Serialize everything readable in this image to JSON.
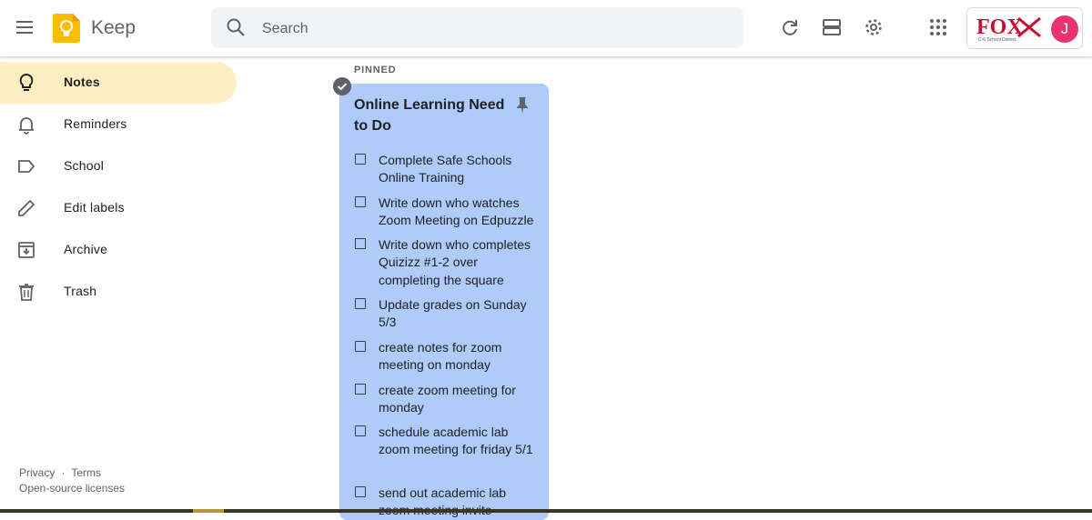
{
  "header": {
    "app_title": "Keep",
    "search_placeholder": "Search",
    "icons": [
      "menu-icon",
      "keep-logo-icon",
      "search-icon",
      "refresh-icon",
      "list-view-icon",
      "settings-icon",
      "apps-grid-icon"
    ],
    "account": {
      "org_logo_text": "FOX",
      "org_logo_subtext": "C-6 School District",
      "avatar_initial": "J",
      "avatar_color": "#e8336d"
    }
  },
  "sidebar": {
    "items": [
      {
        "label": "Notes",
        "icon": "lightbulb-icon",
        "active": true
      },
      {
        "label": "Reminders",
        "icon": "bell-icon",
        "active": false
      },
      {
        "label": "School",
        "icon": "label-icon",
        "active": false
      },
      {
        "label": "Edit labels",
        "icon": "pencil-icon",
        "active": false
      },
      {
        "label": "Archive",
        "icon": "archive-icon",
        "active": false
      },
      {
        "label": "Trash",
        "icon": "trash-icon",
        "active": false
      }
    ],
    "footer": {
      "privacy": "Privacy",
      "separator": "·",
      "terms": "Terms",
      "licenses": "Open-source licenses"
    }
  },
  "main": {
    "section_label": "PINNED",
    "note": {
      "title": "Online Learning Need to Do",
      "color": "#aecbfa",
      "pinned": true,
      "items": [
        "Complete Safe Schools Online Training",
        "Write down who watches Zoom Meeting on Edpuzzle",
        "Write down who completes Quizizz #1-2 over completing the square",
        "Update grades on Sunday 5/3",
        "create notes for zoom meeting on monday",
        "create zoom meeting for monday",
        "schedule academic lab zoom meeting for friday 5/1",
        "send out academic lab zoom meeting invite"
      ]
    }
  },
  "colors": {
    "active_nav": "#feefc3",
    "search_bg": "#f1f3f4",
    "keep_yellow": "#fbbc04",
    "fox_red": "#c8102e"
  }
}
